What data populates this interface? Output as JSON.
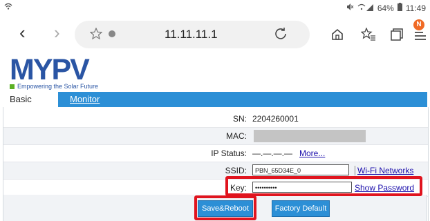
{
  "status_bar": {
    "left_icon": "wifi-icon",
    "battery": "64%",
    "time": "11:49",
    "right_icons": [
      "mute-icon",
      "wifi-icon",
      "signal-icon",
      "battery-icon"
    ]
  },
  "browser": {
    "url": "11.11.11.1",
    "badge": "N"
  },
  "logo": {
    "name": "MYPV",
    "tagline": "Empowering the Solar Future",
    "colors": {
      "blue": "#2a55a4",
      "green": "#5bb025"
    }
  },
  "tabs": {
    "basic": "Basic",
    "monitor": "Monitor"
  },
  "form": {
    "sn_label": "SN:",
    "sn_value": "2204260001",
    "mac_label": "MAC:",
    "ip_label": "IP Status:",
    "ip_value": "—.—.—.—",
    "more_link": "More...",
    "ssid_label": "SSID:",
    "ssid_value": "PBN_65D34E_0",
    "wifi_link": "Wi-Fi Networks",
    "key_label": "Key:",
    "key_value": "••••••••••",
    "show_password": "Show Password",
    "save_button": "Save&Reboot",
    "factory_button": "Factory Default"
  },
  "colors": {
    "accent": "#2c8fd6",
    "highlight": "#e0141e"
  }
}
